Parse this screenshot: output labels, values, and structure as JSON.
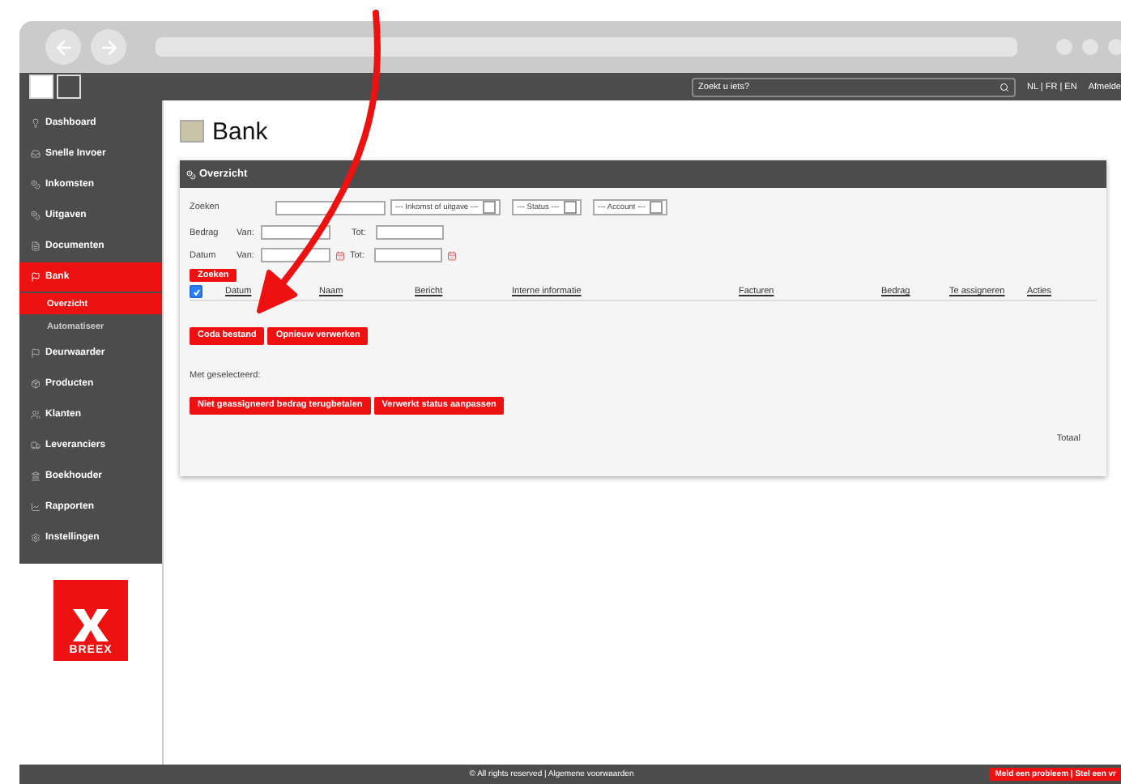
{
  "topbar": {
    "search": {
      "placeholder": "Zoekt u iets?"
    },
    "languages": "NL | FR | EN",
    "logout": "Afmelde"
  },
  "sidebar": {
    "items": [
      {
        "label": "Dashboard",
        "selected": false
      },
      {
        "label": "Snelle Invoer",
        "selected": false
      },
      {
        "label": "Inkomsten",
        "selected": false
      },
      {
        "label": "Uitgaven",
        "selected": false
      },
      {
        "label": "Documenten",
        "selected": false
      },
      {
        "label": "Bank",
        "selected": true,
        "children": [
          {
            "label": "Overzicht",
            "selected": true
          },
          {
            "label": "Automatiseer",
            "selected": false
          }
        ]
      },
      {
        "label": "Deurwaarder",
        "selected": false
      },
      {
        "label": "Producten",
        "selected": false
      },
      {
        "label": "Klanten",
        "selected": false
      },
      {
        "label": "Leveranciers",
        "selected": false
      },
      {
        "label": "Boekhouder",
        "selected": false
      },
      {
        "label": "Rapporten",
        "selected": false
      },
      {
        "label": "Instellingen",
        "selected": false
      }
    ],
    "logo": "BREEX"
  },
  "page_title": "Bank",
  "panel": {
    "title": "Overzicht",
    "filters": {
      "search_label": "Zoeken",
      "selects": [
        "--- Inkomst of uitgave ---",
        "--- Status ---",
        "--- Account ---"
      ],
      "amount_label": "Bedrag",
      "amount_from": "Van:",
      "amount_to": "Tot:",
      "date_label": "Datum",
      "date_from": "Van:",
      "date_to": "Tot:",
      "search_button": "Zoeken"
    },
    "table": {
      "select_all": {
        "checked": true
      },
      "columns": [
        "Datum",
        "Naam",
        "Bericht",
        "Interne informatie",
        "Facturen",
        "Bedrag",
        "Te assigneren",
        "Acties"
      ]
    },
    "actions": [
      "Coda bestand",
      "Opnieuw verwerken"
    ],
    "with_selected": "Met geselecteerd:",
    "bulk_actions": [
      "Niet geassigneerd bedrag terugbetalen",
      "Verwerkt status aanpassen"
    ],
    "total": "Totaal"
  },
  "footer": {
    "copyright": "© All rights reserved | Algemene voorwaarden",
    "report": "Meld een probleem | Stel een vr"
  }
}
